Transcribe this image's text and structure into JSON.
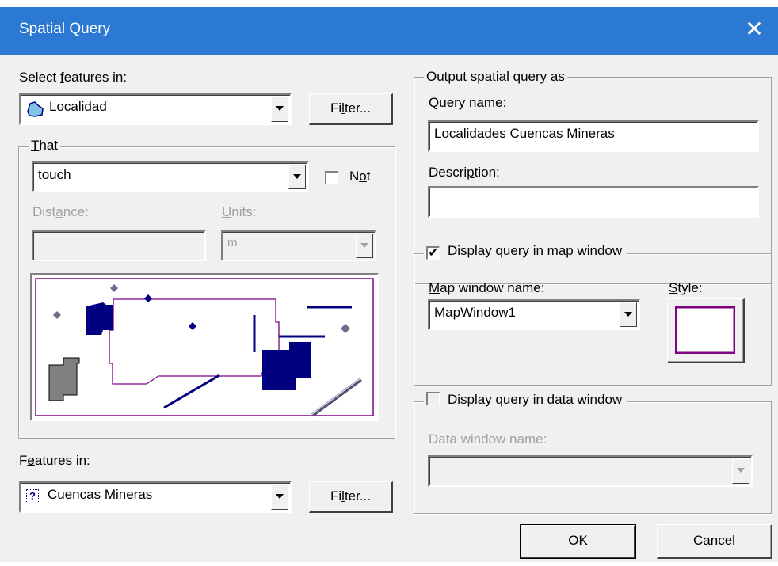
{
  "window": {
    "title": "Spatial Query",
    "close_glyph": "✕"
  },
  "select_features": {
    "label_pre": "Select ",
    "label_acc": "f",
    "label_post": "eatures in:",
    "layer": "Localidad",
    "filter_pre": "Fi",
    "filter_acc": "l",
    "filter_post": "ter..."
  },
  "that_group": {
    "title_acc": "T",
    "title_post": "hat",
    "operator": "touch",
    "not_pre": "N",
    "not_acc": "o",
    "not_post": "t",
    "not_checked": false,
    "distance_pre": "Dist",
    "distance_acc": "a",
    "distance_post": "nce:",
    "distance_value": "",
    "units_acc": "U",
    "units_post": "nits:",
    "units_value": "m"
  },
  "features_in": {
    "label_pre": "F",
    "label_acc": "e",
    "label_post": "atures in:",
    "layer": "Cuencas Mineras",
    "layer_icon": "?",
    "filter_pre": "Fi",
    "filter_acc": "l",
    "filter_post": "ter..."
  },
  "output": {
    "title": "Output spatial query as",
    "query_name_acc": "Q",
    "query_name_post": "uery name:",
    "query_name_value": "Localidades Cuencas Mineras",
    "description_pre": "Descri",
    "description_acc": "p",
    "description_post": "tion:",
    "description_value": ""
  },
  "map_display": {
    "label_pre": "Display query in map ",
    "label_acc": "w",
    "label_post": "indow",
    "checked": true,
    "check_glyph": "✔",
    "window_name_acc": "M",
    "window_name_post": "ap window name:",
    "window_name_value": "MapWindow1",
    "style_acc": "S",
    "style_post": "tyle:"
  },
  "data_display": {
    "label_pre": "Display query in d",
    "label_acc": "a",
    "label_post": "ta window",
    "checked": false,
    "window_name_label": "Data window name:",
    "window_name_value": ""
  },
  "buttons": {
    "ok": "OK",
    "cancel": "Cancel"
  },
  "colors": {
    "titlebar": "#2b79d3",
    "dialog_bg": "#f0f0f0",
    "preview_border": "#800080",
    "preview_shape": "#000080",
    "preview_gray": "#808080",
    "preview_diamond": "#6b6b8a",
    "layer_icon_fill": "#7fc4e8"
  },
  "icons": {
    "layer_region": "polygon-layer-icon",
    "layer_unknown": "unknown-layer-icon",
    "dropdown": "chevron-down-icon"
  }
}
